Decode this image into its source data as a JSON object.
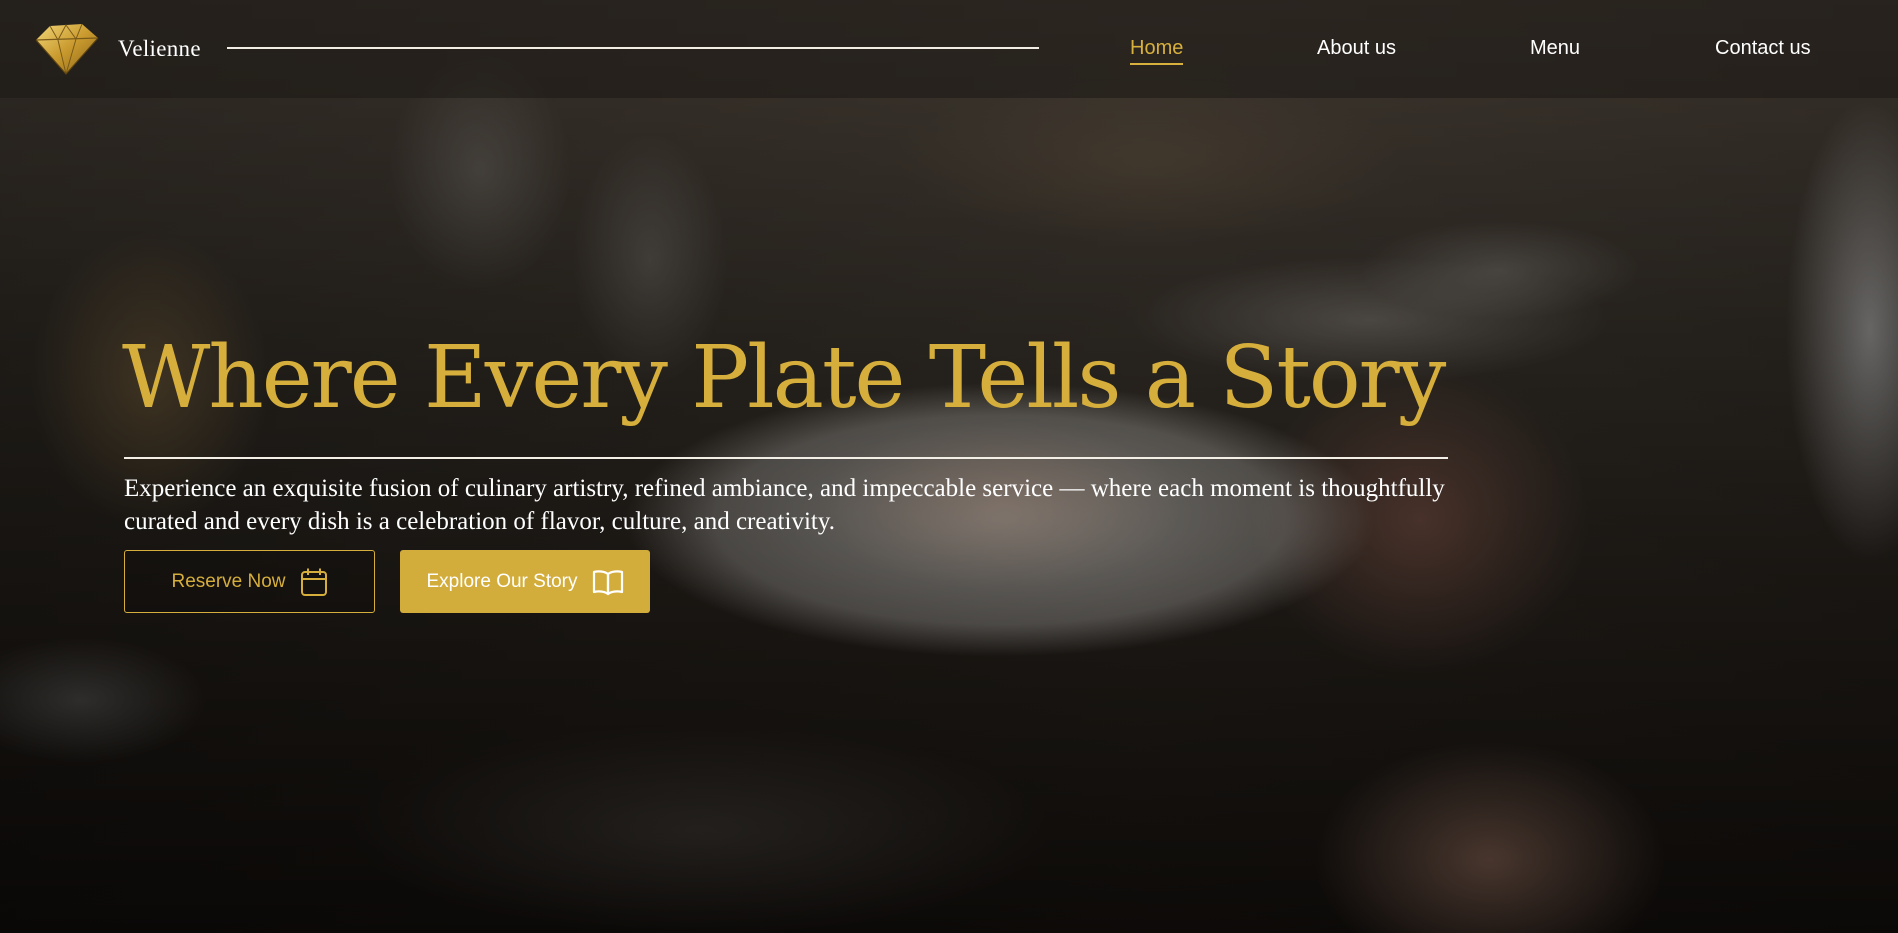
{
  "brand": {
    "name": "Velienne",
    "logo_icon": "diamond-icon"
  },
  "nav": {
    "items": [
      {
        "label": "Home",
        "active": true
      },
      {
        "label": "About us",
        "active": false
      },
      {
        "label": "Menu",
        "active": false
      },
      {
        "label": "Contact us",
        "active": false
      }
    ]
  },
  "hero": {
    "title": "Where Every Plate Tells a Story",
    "subtitle": "Experience an exquisite fusion of culinary artistry, refined ambiance, and impeccable service — where each moment is thoughtfully curated and every dish is a celebration of flavor, culture, and creativity.",
    "background": "restaurant dining table with plated dish (photo)"
  },
  "buttons": {
    "reserve": {
      "label": "Reserve Now",
      "icon": "calendar-icon"
    },
    "explore": {
      "label": "Explore Our Story",
      "icon": "open-book-icon"
    }
  },
  "colors": {
    "accent_gold": "#d6ae3c",
    "text_white": "#ffffff",
    "header_bg": "rgba(28,24,20,0.55)"
  }
}
